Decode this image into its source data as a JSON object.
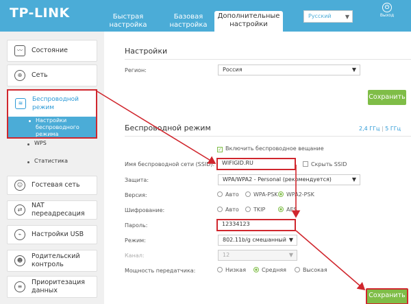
{
  "brand": {
    "logo": "TP-LINK",
    "accent": "#4bacd7",
    "annotation_color": "#d0262d",
    "save_color": "#7fbd47"
  },
  "header": {
    "tabs": [
      {
        "line1": "Быстрая",
        "line2": "настройка"
      },
      {
        "line1": "Базовая",
        "line2": "настройка"
      },
      {
        "line1": "Дополнительные",
        "line2": "настройки"
      }
    ],
    "language": "Русский",
    "logout_icon": "logout-icon",
    "logout_label": "Выход"
  },
  "sidebar": {
    "items": [
      {
        "label": "Состояние",
        "icon": "pulse-icon"
      },
      {
        "label": "Сеть",
        "icon": "globe-icon"
      },
      {
        "label": "Гостевая сеть",
        "icon": "guest-icon"
      },
      {
        "label": "NAT переадресация",
        "icon": "nat-icon"
      },
      {
        "label": "Настройки USB",
        "icon": "usb-icon"
      },
      {
        "label1": "Родительский",
        "label2": "контроль",
        "icon": "parental-icon"
      },
      {
        "label1": "Приоритезация",
        "label2": "данных",
        "icon": "priority-icon"
      }
    ],
    "wireless": {
      "label1": "Беспроводной",
      "label2": "режим",
      "icon": "wifi-icon",
      "subitems": [
        {
          "line1": "Настройки",
          "line2": "беспроводного",
          "line3": "режима"
        },
        {
          "label": "WPS"
        },
        {
          "label": "Статистика"
        }
      ]
    }
  },
  "settings": {
    "title": "Настройки",
    "region_label": "Регион:",
    "region_value": "Россия",
    "save_label": "Сохранить"
  },
  "wireless": {
    "title": "Беспроводной режим",
    "band1": "2,4 ГГц",
    "separator": "|",
    "band2": "5 ГГц",
    "enable_label": "Включить беспроводное вещание",
    "ssid_label": "Имя беспроводной сети (SSID):",
    "ssid_value": "WIFIGID.RU",
    "hide_ssid_label": "Скрыть SSID",
    "security_label": "Защита:",
    "security_value": "WPA/WPA2 - Personal (рекомендуется)",
    "version_label": "Версия:",
    "version_options": [
      "Авто",
      "WPA-PSK",
      "WPA2-PSK"
    ],
    "encryption_label": "Шифрование:",
    "encryption_options": [
      "Авто",
      "TKIP",
      "AES"
    ],
    "password_label": "Пароль:",
    "password_value": "12334123",
    "mode_label": "Режим:",
    "mode_value": "802.11b/g смешанный",
    "channel_label": "Канал:",
    "channel_value": "12",
    "power_label": "Мощность передатчика:",
    "power_options": [
      "Низкая",
      "Средняя",
      "Высокая"
    ],
    "save_label": "Сохранить"
  }
}
